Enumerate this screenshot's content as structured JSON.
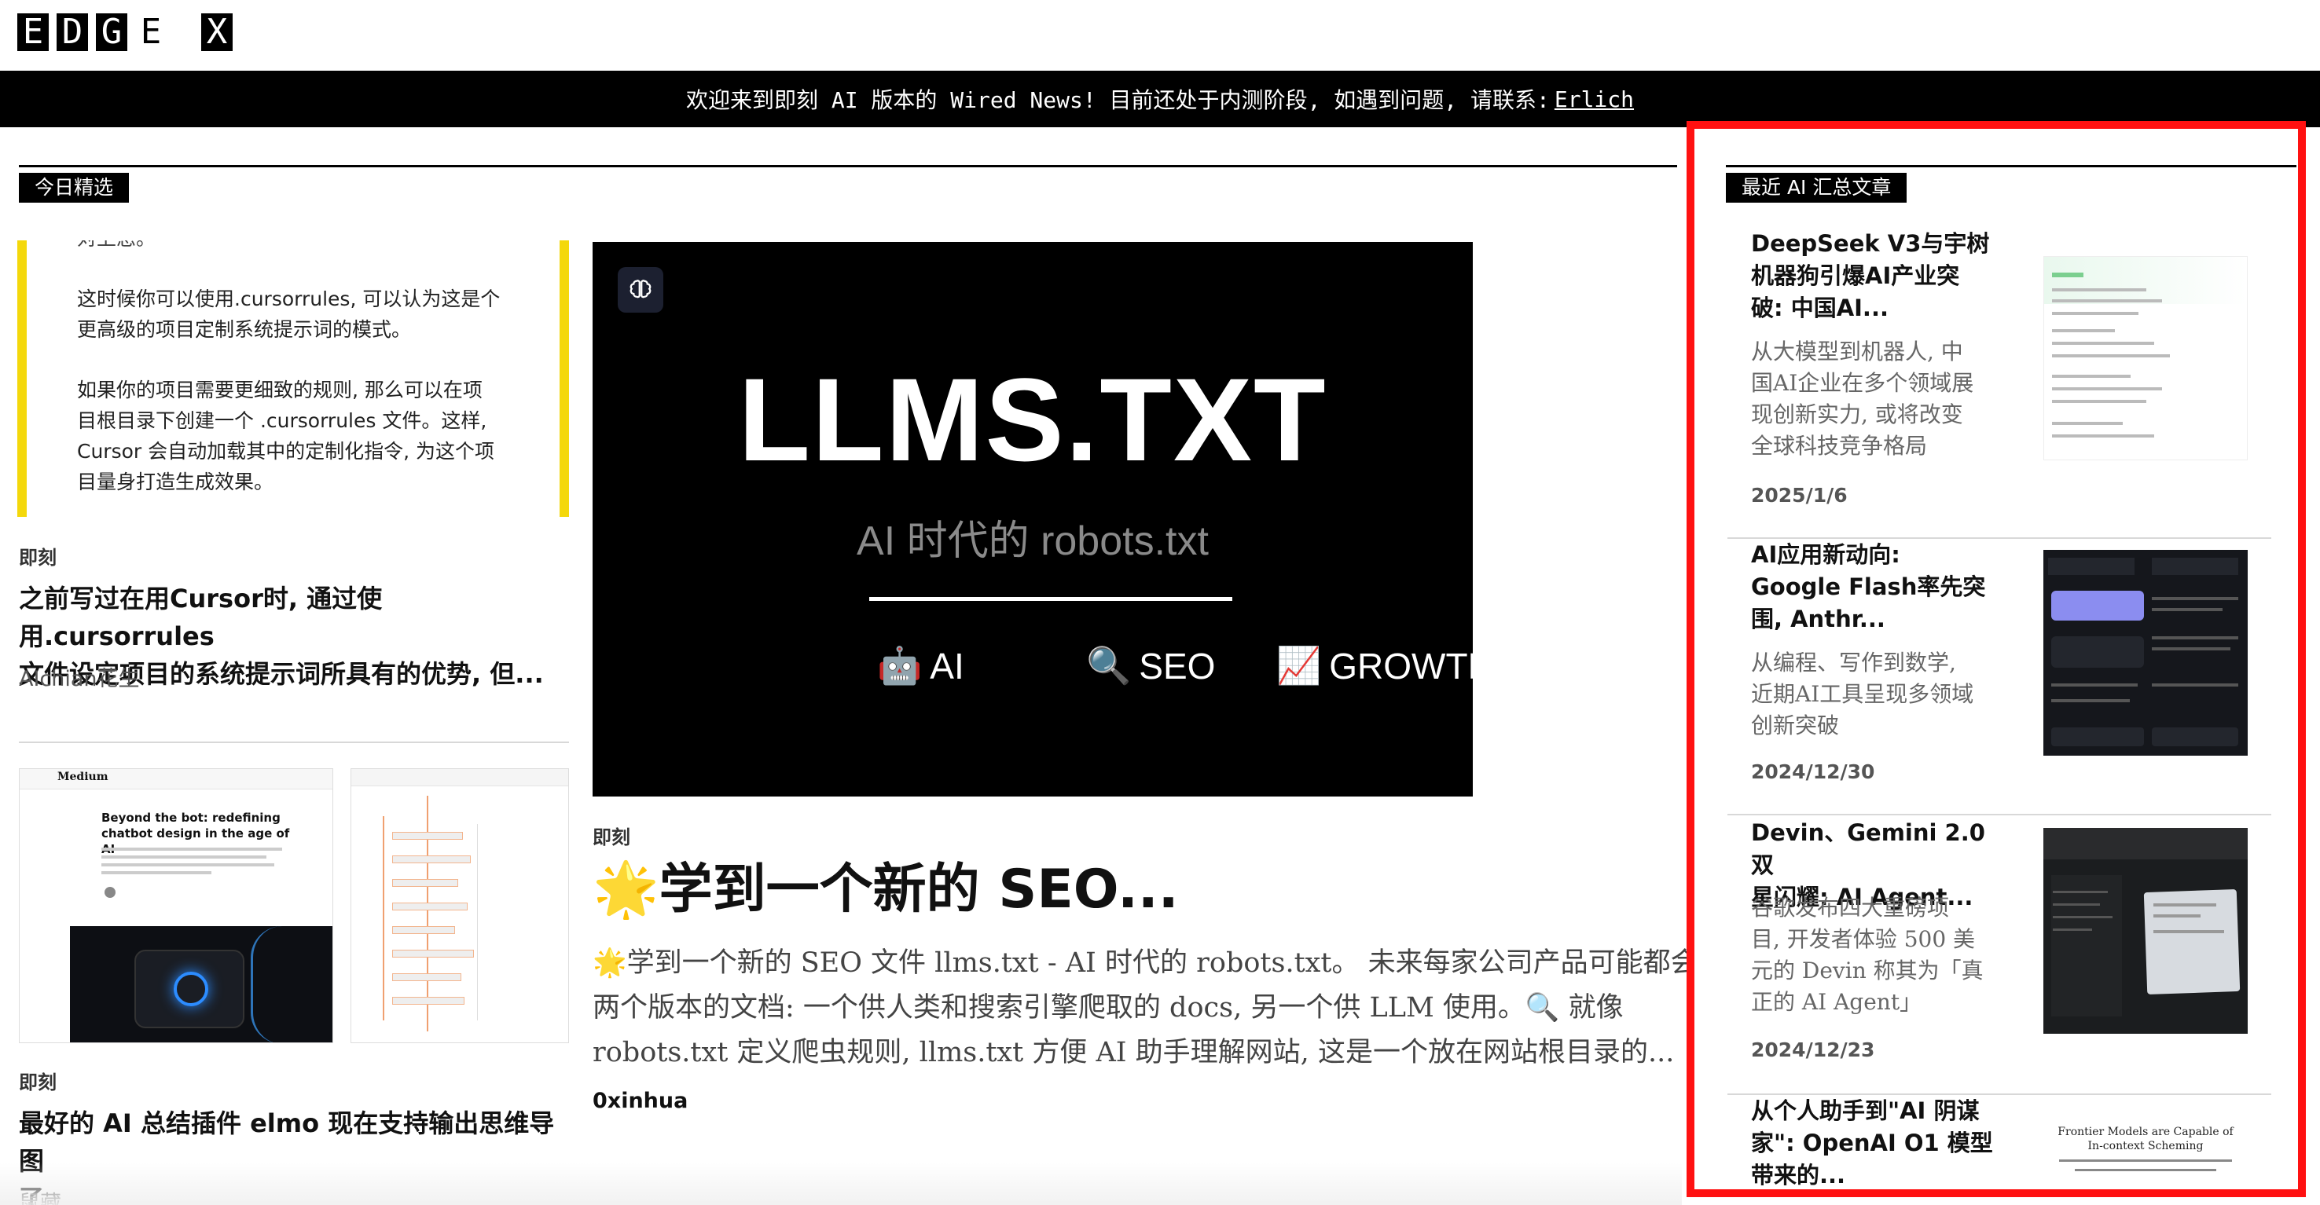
{
  "logo": {
    "letters": [
      "E",
      "D",
      "G",
      "E",
      "X"
    ]
  },
  "banner": {
    "text": "欢迎来到即刻 AI 版本的 Wired News! 目前还处于内测阶段, 如遇到问题, 请联系:",
    "link": "Erlich"
  },
  "sections": {
    "today": "今日精选",
    "recent": "最近 AI 汇总文章"
  },
  "left_top": {
    "quote_cut": "对上您。",
    "quote_p1": [
      "这时候你可以使用.cursorrules, 可以认为这是个",
      "更高级的项目定制系统提示词的模式。"
    ],
    "quote_p2": [
      "如果你的项目需要更细致的规则, 那么可以在项",
      "目根目录下创建一个 .cursorrules 文件。这样,",
      "Cursor 会自动加载其中的定制化指令, 为这个项",
      "目量身打造生成效果。"
    ],
    "category": "即刻",
    "title_lines": [
      "之前写过在用Cursor时, 通过使用.cursorrules",
      "文件设定项目的系统提示词所具有的优势, 但..."
    ],
    "author": "AIchian花生"
  },
  "left_bottom": {
    "shot_left_brand": "Medium",
    "shot_left_heading": "Beyond the bot: redefining chatbot design in the age of AI",
    "category": "即刻",
    "title_lines": [
      "最好的 AI 总结插件 elmo 现在支持输出思维导图",
      "了"
    ],
    "author": "鼠藏"
  },
  "hero": {
    "badge_icon": "brain-icon",
    "title": "LLMS.TXT",
    "subtitle": "AI 时代的 robots.txt",
    "tag1_icon": "🤖",
    "tag1": "AI",
    "tag2_icon": "🔍",
    "tag2": "SEO",
    "tag3_icon": "📈",
    "tag3": "GROWTH",
    "category": "即刻",
    "headline": "🌟学到一个新的 SEO...",
    "excerpt_lines": [
      "🌟学到一个新的 SEO 文件 llms.txt - AI 时代的 robots.txt。 未来每家公司产品可能都会提供",
      "两个版本的文档: 一个供人类和搜索引擎爬取的 docs, 另一个供 LLM 使用。🔍 就像",
      "robots.txt 定义爬虫规则, llms.txt 方便 AI 助手理解网站, 这是一个放在网站根目录的..."
    ],
    "author": "0xinhua"
  },
  "recent": [
    {
      "title_lines": [
        "DeepSeek V3与宇树",
        "机器狗引爆AI产业突",
        "破: 中国AI..."
      ],
      "desc_lines": [
        "从大模型到机器人, 中",
        "国AI企业在多个领域展",
        "现创新实力, 或将改变",
        "全球科技竞争格局"
      ],
      "date": "2025/1/6"
    },
    {
      "title_lines": [
        "AI应用新动向:",
        "Google Flash率先突",
        "围, Anthr..."
      ],
      "desc_lines": [
        "从编程、写作到数学,",
        "近期AI工具呈现多领域",
        "创新突破"
      ],
      "date": "2024/12/30"
    },
    {
      "title_lines": [
        "Devin、Gemini 2.0 双",
        "星闪耀: AI Agent..."
      ],
      "desc_lines": [
        "谷歌发布四大重磅项",
        "目, 开发者体验 500 美",
        "元的 Devin 称其为「真",
        "正的 AI Agent」"
      ],
      "date": "2024/12/23"
    },
    {
      "title_lines": [
        "从个人助手到\"AI 阴谋",
        "家\": OpenAI O1 模型",
        "带来的..."
      ],
      "thumb_title": "Frontier Models are Capable of In-context Scheming"
    }
  ],
  "colors": {
    "accent_red": "#ff1111",
    "quote_bar": "#f4d80b"
  }
}
